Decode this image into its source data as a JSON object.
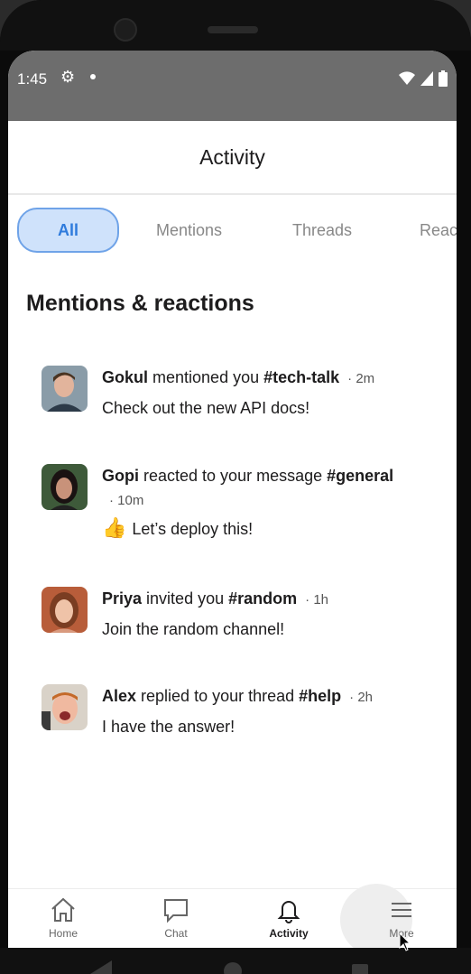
{
  "status_bar": {
    "time": "1:45"
  },
  "header": {
    "title": "Activity"
  },
  "tabs": [
    {
      "label": "All",
      "active": true
    },
    {
      "label": "Mentions"
    },
    {
      "label": "Threads"
    },
    {
      "label": "Reac"
    }
  ],
  "section": {
    "title": "Mentions & reactions"
  },
  "activity": [
    {
      "name": "Gokul",
      "action": " mentioned you ",
      "channel": "#tech-talk",
      "time": "· 2m",
      "message": "Check out the new API docs!",
      "emoji": ""
    },
    {
      "name": "Gopi",
      "action": " reacted to your message ",
      "channel": "#general",
      "time": "· 10m",
      "message": "Let’s deploy this!",
      "emoji": "👍"
    },
    {
      "name": "Priya",
      "action": " invited you ",
      "channel": "#random",
      "time": "· 1h",
      "message": "Join the random channel!",
      "emoji": ""
    },
    {
      "name": "Alex",
      "action": " replied to your thread ",
      "channel": "#help",
      "time": "· 2h",
      "message": "I have the answer!",
      "emoji": ""
    }
  ],
  "bottom_nav": [
    {
      "label": "Home",
      "icon": "home-icon"
    },
    {
      "label": "Chat",
      "icon": "chat-icon"
    },
    {
      "label": "Activity",
      "icon": "bell-icon",
      "active": true
    },
    {
      "label": "More",
      "icon": "menu-icon"
    }
  ],
  "colors": {
    "accent": "#2f7bdc",
    "accent_bg": "#cfe2fb",
    "status_bar": "#6d6d6d"
  }
}
